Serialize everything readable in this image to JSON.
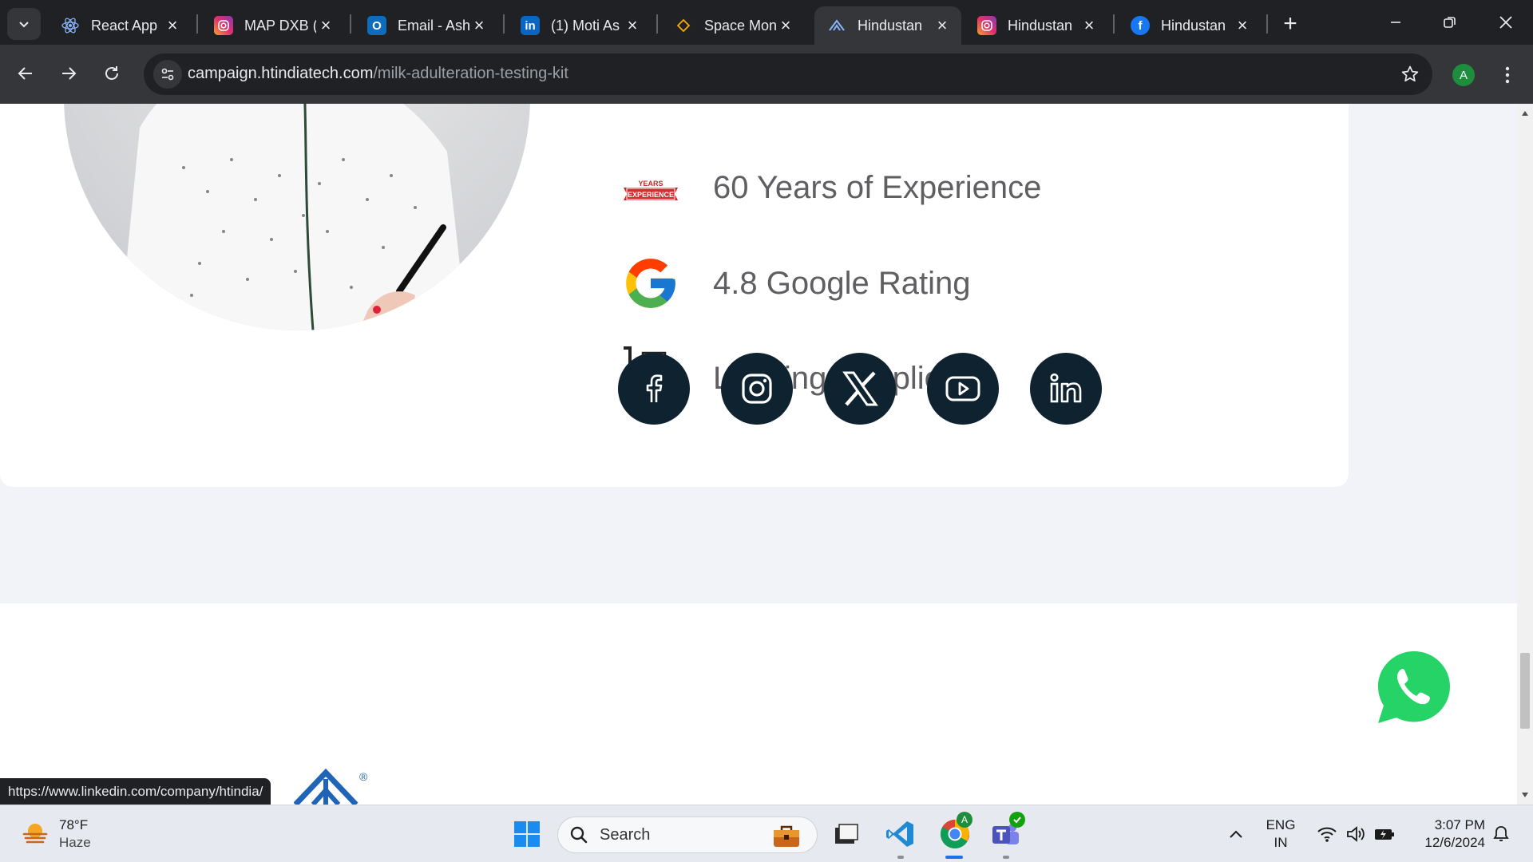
{
  "browser": {
    "tabs": [
      {
        "title": "React App",
        "icon": "react-icon",
        "active": false
      },
      {
        "title": "MAP DXB (",
        "icon": "instagram-icon",
        "active": false
      },
      {
        "title": "Email - Ash",
        "icon": "outlook-icon",
        "active": false
      },
      {
        "title": "(1) Moti As",
        "icon": "linkedin-icon",
        "active": false
      },
      {
        "title": "Space Mon",
        "icon": "diamond-icon",
        "active": false
      },
      {
        "title": "Hindustan",
        "icon": "hindustan-logo-icon",
        "active": true
      },
      {
        "title": "Hindustan",
        "icon": "instagram-icon",
        "active": false
      },
      {
        "title": "Hindustan",
        "icon": "facebook-icon",
        "active": false
      }
    ],
    "url_host": "campaign.htindiatech.com",
    "url_path": "/milk-adulteration-testing-kit",
    "profile_initial": "A"
  },
  "page": {
    "features": [
      {
        "text": "60 Years of Experience",
        "badge_top": "YEARS",
        "badge_bottom": "EXPERIENCE"
      },
      {
        "text": "4.8 Google Rating"
      },
      {
        "text": "Leading Suppliers"
      }
    ],
    "social_links": [
      "facebook-icon",
      "instagram-icon",
      "x-icon",
      "youtube-icon",
      "linkedin-icon"
    ],
    "brand_mark": "®",
    "status_url": "https://www.linkedin.com/company/htindia/"
  },
  "taskbar": {
    "weather_temp": "78°F",
    "weather_desc": "Haze",
    "search_placeholder": "Search",
    "lang_top": "ENG",
    "lang_bottom": "IN",
    "time": "3:07 PM",
    "date": "12/6/2024",
    "chrome_badge": "A"
  },
  "colors": {
    "social_bg": "#0e2230",
    "whatsapp_green": "#25d366",
    "tab_bg": "#202124",
    "toolbar_bg": "#35363a"
  }
}
